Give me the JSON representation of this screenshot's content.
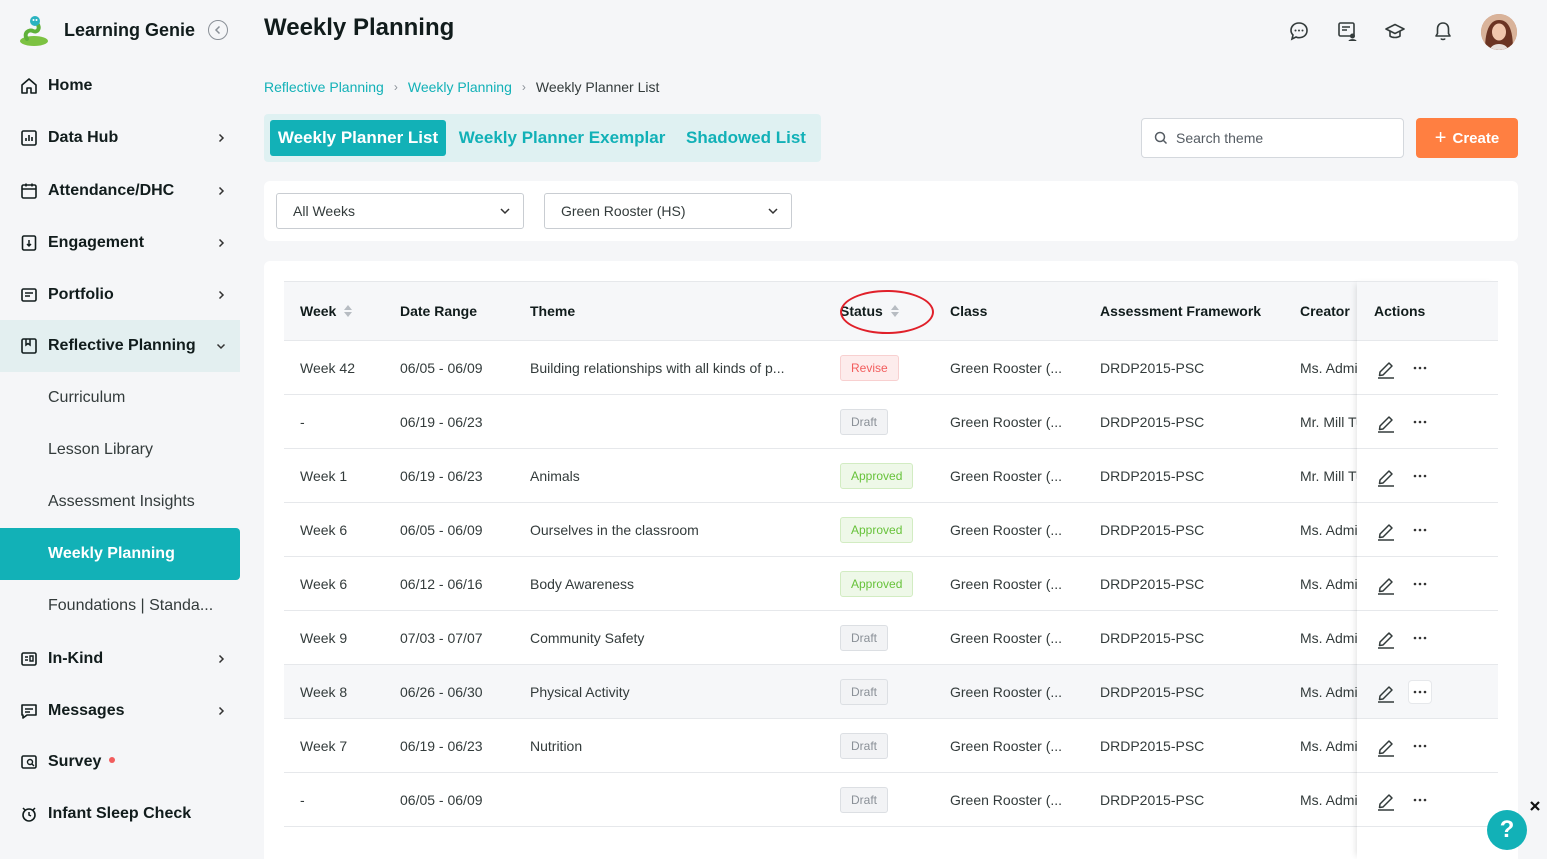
{
  "app": {
    "name": "Learning Genie"
  },
  "sidebar": {
    "items": [
      {
        "label": "Home",
        "icon": "home-icon"
      },
      {
        "label": "Data Hub",
        "icon": "chart-icon"
      },
      {
        "label": "Attendance/DHC",
        "icon": "calendar-icon"
      },
      {
        "label": "Engagement",
        "icon": "engagement-icon"
      },
      {
        "label": "Portfolio",
        "icon": "portfolio-icon"
      },
      {
        "label": "Reflective Planning",
        "icon": "planning-icon"
      },
      {
        "label": "In-Kind",
        "icon": "in-kind-icon"
      },
      {
        "label": "Messages",
        "icon": "message-icon"
      },
      {
        "label": "Survey",
        "icon": "survey-icon"
      },
      {
        "label": "Infant Sleep Check",
        "icon": "alarm-clock-icon"
      }
    ],
    "subitems": [
      {
        "label": "Curriculum"
      },
      {
        "label": "Lesson Library"
      },
      {
        "label": "Assessment Insights"
      },
      {
        "label": "Weekly Planning"
      },
      {
        "label": "Foundations | Standa..."
      }
    ]
  },
  "header": {
    "title": "Weekly Planning"
  },
  "breadcrumb": {
    "items": [
      "Reflective Planning",
      "Weekly Planning"
    ],
    "current": "Weekly Planner List"
  },
  "tabs": [
    "Weekly Planner List",
    "Weekly Planner Exemplar",
    "Shadowed List"
  ],
  "search": {
    "placeholder": "Search theme"
  },
  "create_label": "Create",
  "filters": {
    "week": "All Weeks",
    "class": "Green Rooster (HS)"
  },
  "table": {
    "columns": [
      "Week",
      "Date Range",
      "Theme",
      "Status",
      "Class",
      "Assessment Framework",
      "Creator",
      "Actions"
    ],
    "rows": [
      {
        "week": "Week 42",
        "date": "06/05 - 06/09",
        "theme": "Building relationships with all kinds of p...",
        "status": "Revise",
        "class": "Green Rooster (...",
        "framework": "DRDP2015-PSC",
        "creator": "Ms. Admin F"
      },
      {
        "week": "-",
        "date": "06/19 - 06/23",
        "theme": "",
        "status": "Draft",
        "class": "Green Rooster (...",
        "framework": "DRDP2015-PSC",
        "creator": "Mr. Mill Turr"
      },
      {
        "week": "Week 1",
        "date": "06/19 - 06/23",
        "theme": "Animals",
        "status": "Approved",
        "class": "Green Rooster (...",
        "framework": "DRDP2015-PSC",
        "creator": "Mr. Mill Turr"
      },
      {
        "week": "Week 6",
        "date": "06/05 - 06/09",
        "theme": "Ourselves in the classroom",
        "status": "Approved",
        "class": "Green Rooster (...",
        "framework": "DRDP2015-PSC",
        "creator": "Ms. Admin F"
      },
      {
        "week": "Week 6",
        "date": "06/12 - 06/16",
        "theme": "Body Awareness",
        "status": "Approved",
        "class": "Green Rooster (...",
        "framework": "DRDP2015-PSC",
        "creator": "Ms. Admin F"
      },
      {
        "week": "Week 9",
        "date": "07/03 - 07/07",
        "theme": "Community Safety",
        "status": "Draft",
        "class": "Green Rooster (...",
        "framework": "DRDP2015-PSC",
        "creator": "Ms. Admin F"
      },
      {
        "week": "Week 8",
        "date": "06/26 - 06/30",
        "theme": "Physical Activity",
        "status": "Draft",
        "class": "Green Rooster (...",
        "framework": "DRDP2015-PSC",
        "creator": "Ms. Admin F"
      },
      {
        "week": "Week 7",
        "date": "06/19 - 06/23",
        "theme": "Nutrition",
        "status": "Draft",
        "class": "Green Rooster (...",
        "framework": "DRDP2015-PSC",
        "creator": "Ms. Admin F"
      },
      {
        "week": "-",
        "date": "06/05 - 06/09",
        "theme": "",
        "status": "Draft",
        "class": "Green Rooster (...",
        "framework": "DRDP2015-PSC",
        "creator": "Ms. Admin F"
      }
    ]
  },
  "help": {
    "label": "?"
  },
  "colors": {
    "accent": "#12b1b7",
    "create": "#ff7f41",
    "revise": "#f25d5d",
    "approved": "#67c23a",
    "draft": "#8a9097"
  }
}
